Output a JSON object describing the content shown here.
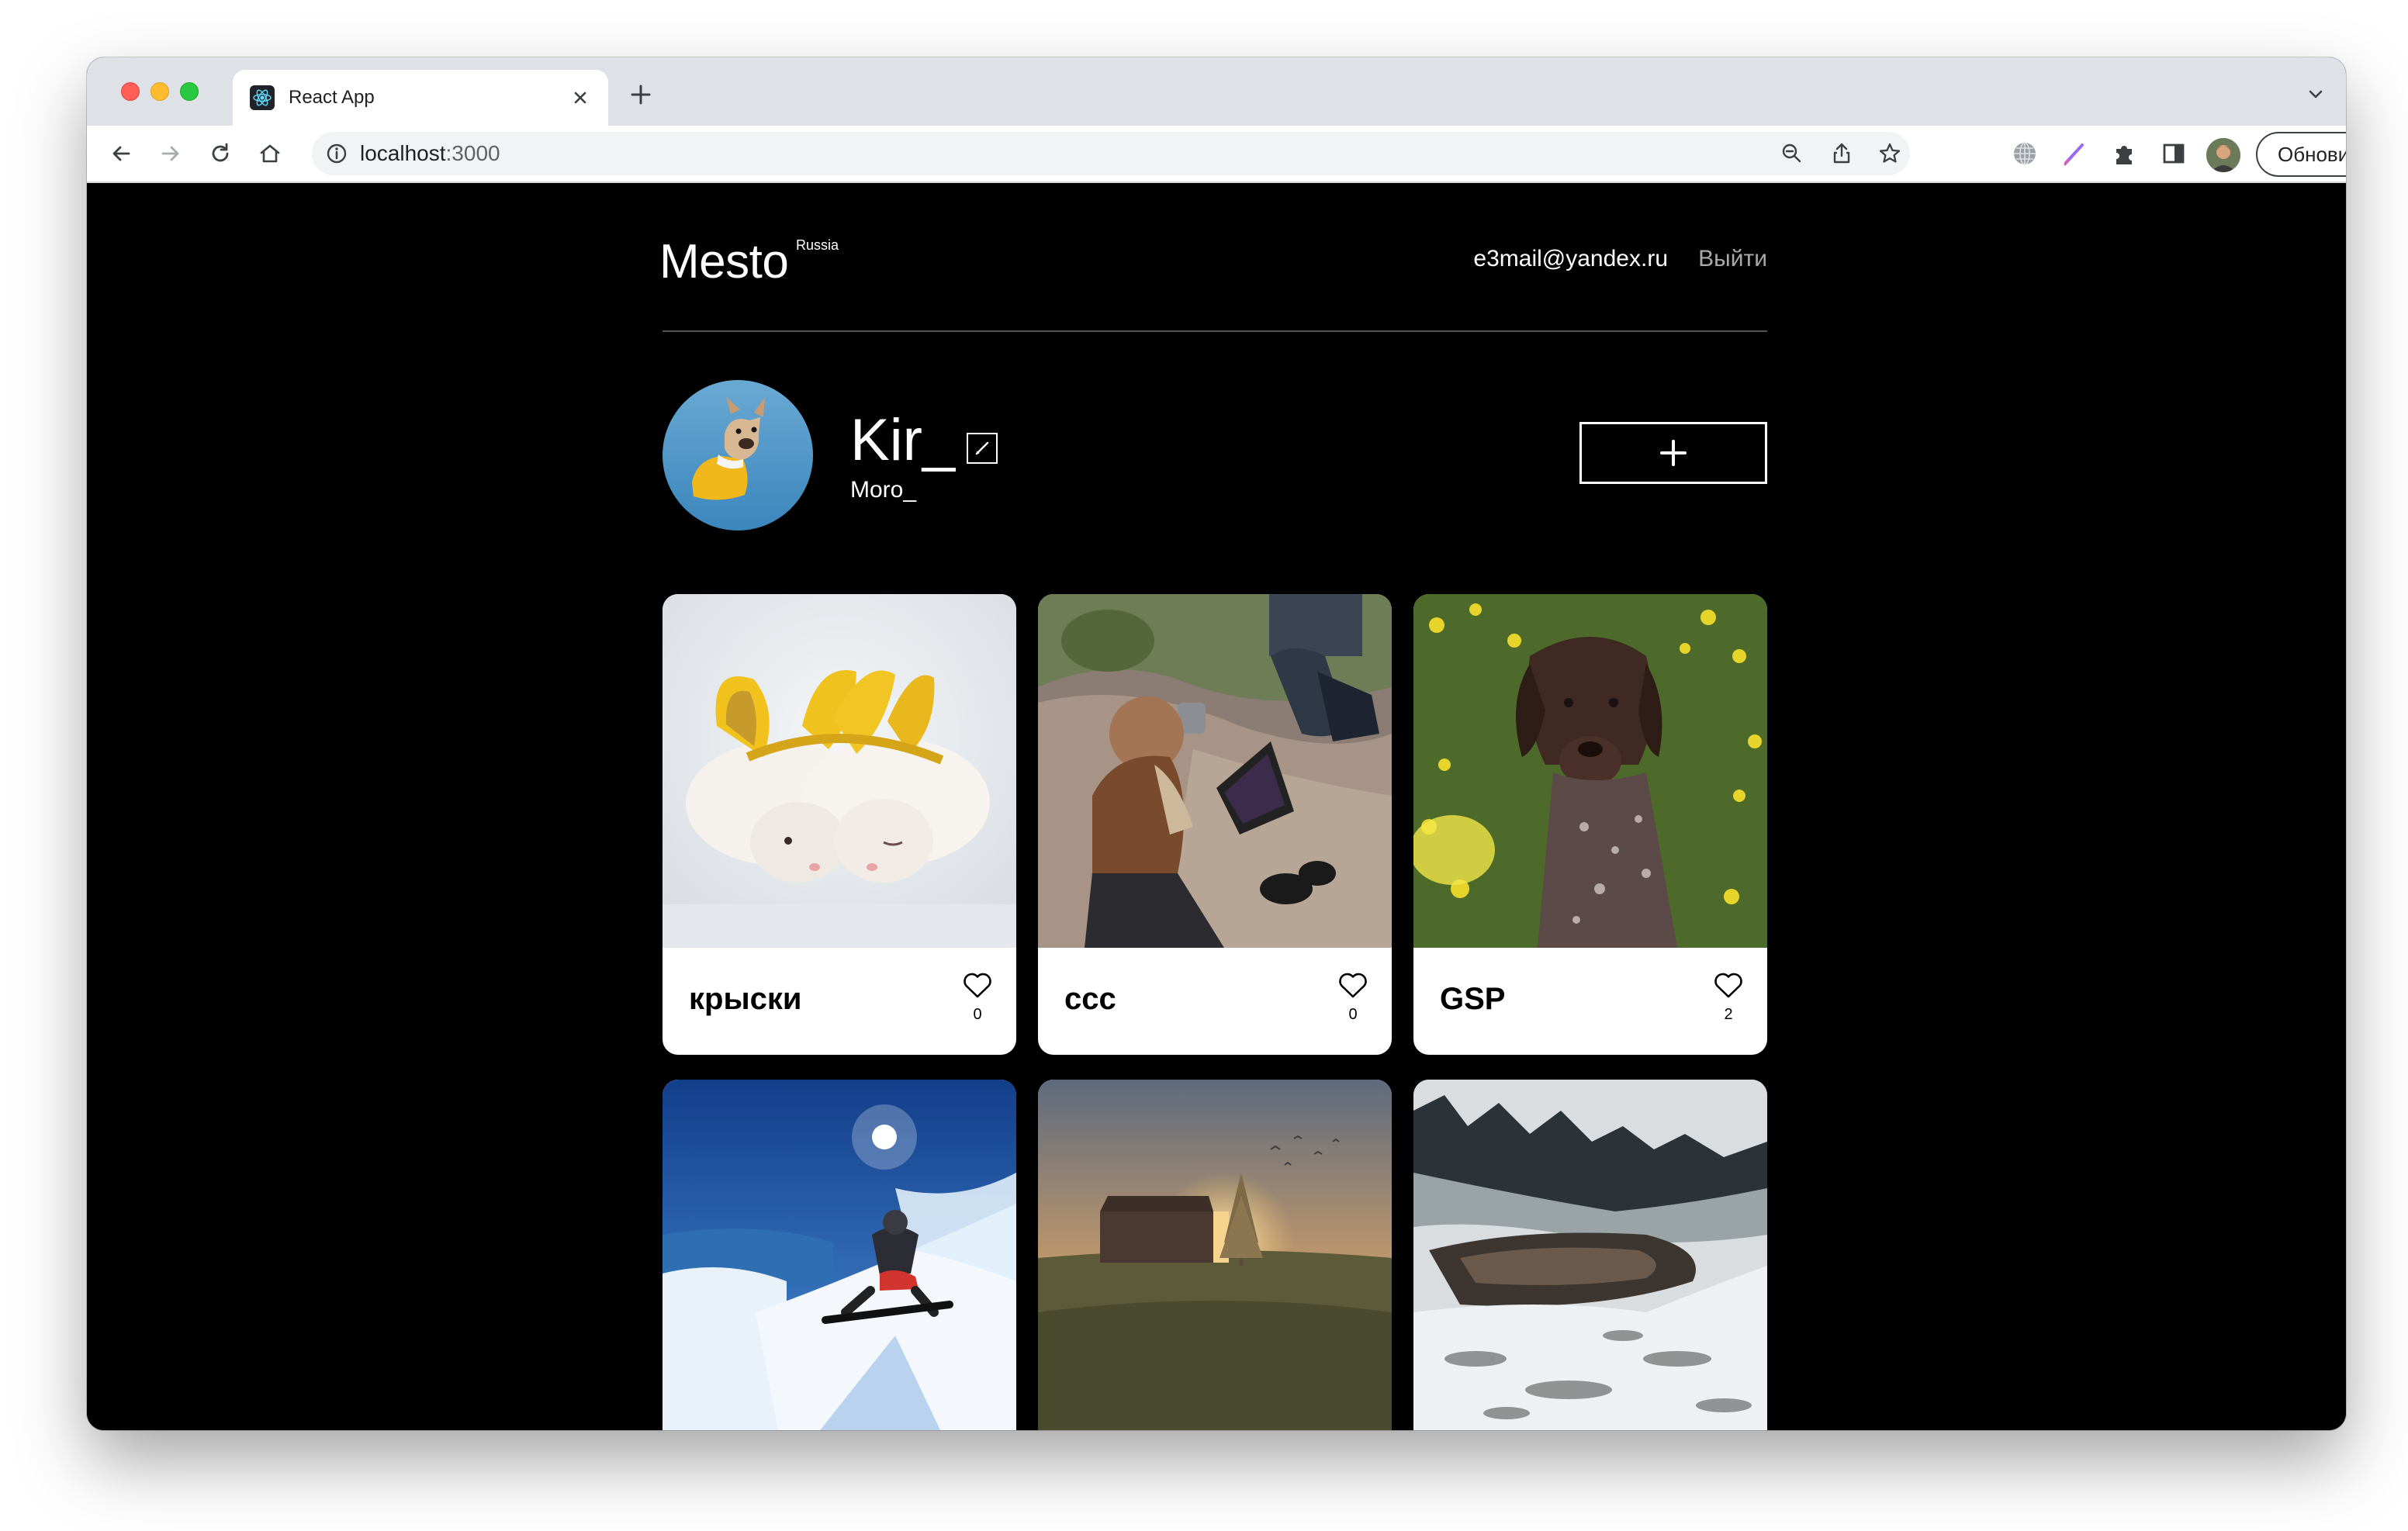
{
  "browser": {
    "tab_title": "React App",
    "url_host": "localhost",
    "url_port": ":3000",
    "update_label": "Обновить"
  },
  "header": {
    "logo": "Mesto",
    "logo_sup": "Russia",
    "email": "e3mail@yandex.ru",
    "logout": "Выйти"
  },
  "profile": {
    "name": "Kir_",
    "about": "Moro_"
  },
  "cards": [
    {
      "title": "крыски",
      "likes": "0"
    },
    {
      "title": "ccc",
      "likes": "0"
    },
    {
      "title": "GSP",
      "likes": "2"
    },
    {
      "title": "",
      "likes": ""
    },
    {
      "title": "",
      "likes": ""
    },
    {
      "title": "",
      "likes": ""
    }
  ],
  "colors": {
    "page_bg": "#000000",
    "card_bg": "#ffffff",
    "logout_text": "#a9a9a9",
    "header_rule": "#545454",
    "tabstrip_bg": "#dee1e6"
  },
  "icons": [
    "react-favicon-icon",
    "close-icon",
    "plus-icon",
    "chevron-down-icon",
    "back-arrow-icon",
    "forward-arrow-icon",
    "reload-icon",
    "home-icon",
    "info-icon",
    "zoom-out-icon",
    "share-icon",
    "star-icon",
    "globe-icon",
    "pen-icon",
    "puzzle-icon",
    "sidebar-icon",
    "edit-pencil-icon",
    "heart-icon"
  ]
}
